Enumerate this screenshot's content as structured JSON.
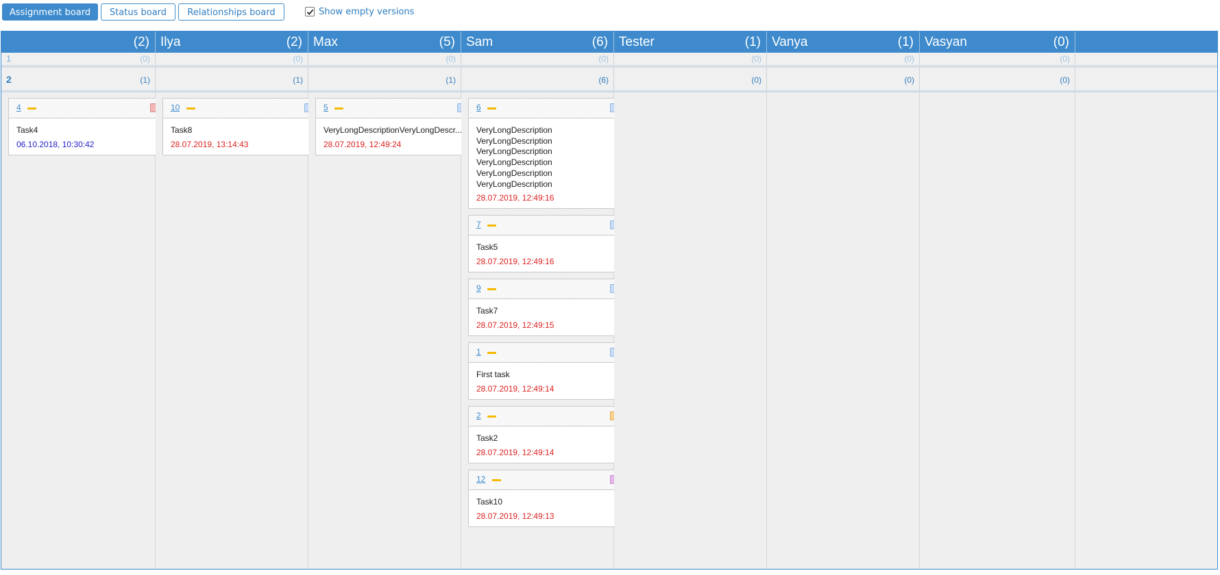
{
  "toolbar": {
    "assignment_board": "Assignment board",
    "status_board": "Status board",
    "relationships_board": "Relationships board",
    "show_empty_versions": "Show empty versions",
    "show_empty_checked": true
  },
  "columns": [
    {
      "name": "",
      "count": "(2)"
    },
    {
      "name": "Ilya",
      "count": "(2)"
    },
    {
      "name": "Max",
      "count": "(5)"
    },
    {
      "name": "Sam",
      "count": "(6)"
    },
    {
      "name": "Tester",
      "count": "(1)"
    },
    {
      "name": "Vanya",
      "count": "(1)"
    },
    {
      "name": "Vasyan",
      "count": "(0)"
    }
  ],
  "versions": [
    {
      "label": "1",
      "counts": [
        "(0)",
        "(0)",
        "(0)",
        "(0)",
        "(0)",
        "(0)",
        "(0)"
      ]
    },
    {
      "label": "2",
      "counts": [
        "(1)",
        "(1)",
        "(1)",
        "(6)",
        "(0)",
        "(0)",
        "(0)"
      ]
    }
  ],
  "cards": [
    {
      "col": 0,
      "id": "4",
      "lines": [
        "Task4"
      ],
      "date": "06.10.2018, 10:30:42",
      "date_color": "#2222cc",
      "swatch": "#f3b6b6",
      "swatch_border": "#d98c8c"
    },
    {
      "col": 1,
      "id": "10",
      "lines": [
        "Task8"
      ],
      "date": "28.07.2019, 13:14:43",
      "date_color": "#dd2222",
      "swatch": "#c8ddf5",
      "swatch_border": "#8fb6e0"
    },
    {
      "col": 2,
      "id": "5",
      "lines": [
        "VeryLongDescriptionVeryLongDescr..."
      ],
      "date": "28.07.2019, 12:49:24",
      "date_color": "#dd2222",
      "swatch": "#c8ddf5",
      "swatch_border": "#8fb6e0"
    },
    {
      "col": 3,
      "id": "6",
      "lines": [
        "VeryLongDescription",
        "VeryLongDescription",
        "VeryLongDescription",
        "VeryLongDescription",
        "VeryLongDescription",
        "VeryLongDescription"
      ],
      "date": "28.07.2019, 12:49:16",
      "date_color": "#dd2222",
      "swatch": "#c8ddf5",
      "swatch_border": "#8fb6e0"
    },
    {
      "col": 3,
      "id": "7",
      "lines": [
        "Task5"
      ],
      "date": "28.07.2019, 12:49:16",
      "date_color": "#dd2222",
      "swatch": "#c8ddf5",
      "swatch_border": "#8fb6e0"
    },
    {
      "col": 3,
      "id": "9",
      "lines": [
        "Task7"
      ],
      "date": "28.07.2019, 12:49:15",
      "date_color": "#dd2222",
      "swatch": "#c8ddf5",
      "swatch_border": "#8fb6e0"
    },
    {
      "col": 3,
      "id": "1",
      "lines": [
        "First task"
      ],
      "date": "28.07.2019, 12:49:14",
      "date_color": "#dd2222",
      "swatch": "#c8ddf5",
      "swatch_border": "#8fb6e0"
    },
    {
      "col": 3,
      "id": "2",
      "lines": [
        "Task2"
      ],
      "date": "28.07.2019, 12:49:14",
      "date_color": "#dd2222",
      "swatch": "#fbd18f",
      "swatch_border": "#e0a850"
    },
    {
      "col": 3,
      "id": "12",
      "lines": [
        "Task10"
      ],
      "date": "28.07.2019, 12:49:13",
      "date_color": "#dd2222",
      "swatch": "#e6b6ea",
      "swatch_border": "#c98fcf"
    }
  ],
  "icons": {
    "checkbox": "check-icon",
    "priority": "priority-dash-icon",
    "tracker": "tracker-color-swatch-icon"
  },
  "colors": {
    "accent": "#3d8bcd",
    "priority": "#f5b800",
    "overdue_date": "#dd2222",
    "date": "#2222cc"
  }
}
